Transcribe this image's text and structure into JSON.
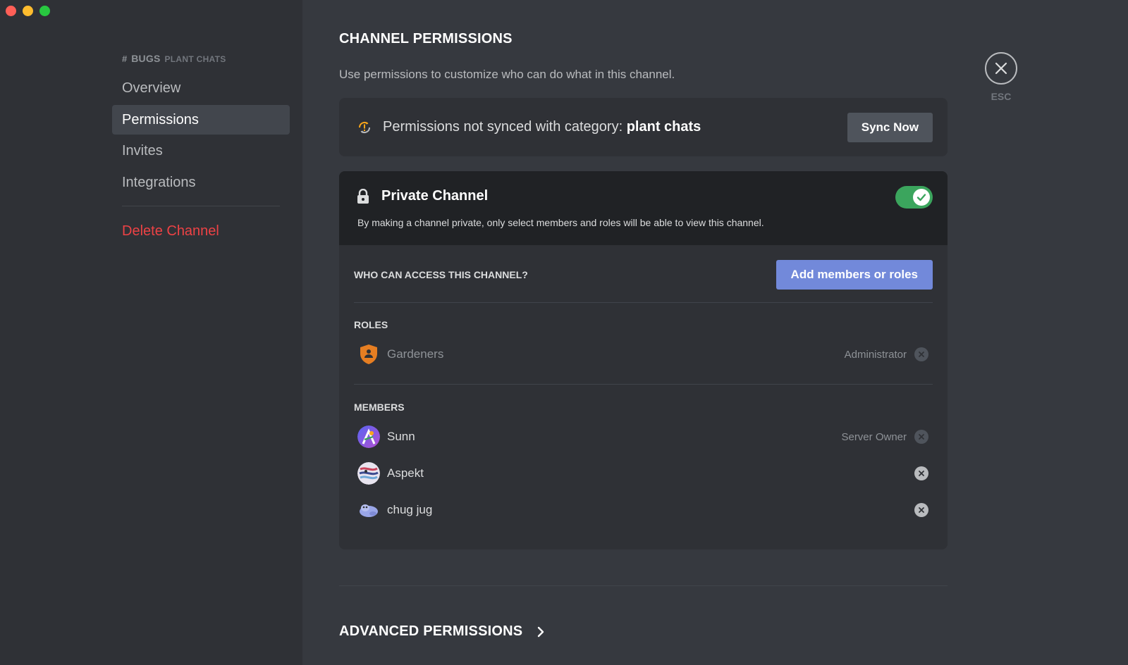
{
  "sidebar": {
    "channel_hash": "#",
    "channel_name": "BUGS",
    "category": "PLANT CHATS",
    "items": [
      {
        "label": "Overview"
      },
      {
        "label": "Permissions"
      },
      {
        "label": "Invites"
      },
      {
        "label": "Integrations"
      }
    ],
    "delete_label": "Delete Channel"
  },
  "main": {
    "title": "CHANNEL PERMISSIONS",
    "description": "Use permissions to customize who can do what in this channel.",
    "sync": {
      "text": "Permissions not synced with category: ",
      "category": "plant chats",
      "button": "Sync Now"
    },
    "private": {
      "title": "Private Channel",
      "description": "By making a channel private, only select members and roles will be able to view this channel.",
      "enabled": true
    },
    "access": {
      "label": "WHO CAN ACCESS THIS CHANNEL?",
      "button": "Add members or roles"
    },
    "roles": {
      "label": "ROLES",
      "items": [
        {
          "name": "Gardeners",
          "tag": "Administrator",
          "icon": "shield-icon",
          "color": "#e67e22"
        }
      ]
    },
    "members": {
      "label": "MEMBERS",
      "items": [
        {
          "name": "Sunn",
          "tag": "Server Owner"
        },
        {
          "name": "Aspekt",
          "tag": ""
        },
        {
          "name": "chug jug",
          "tag": ""
        }
      ]
    },
    "advanced": "ADVANCED PERMISSIONS"
  },
  "close": {
    "label": "ESC"
  },
  "colors": {
    "accent": "#7289da",
    "toggle_on": "#3ba55d",
    "danger": "#ed4245"
  }
}
